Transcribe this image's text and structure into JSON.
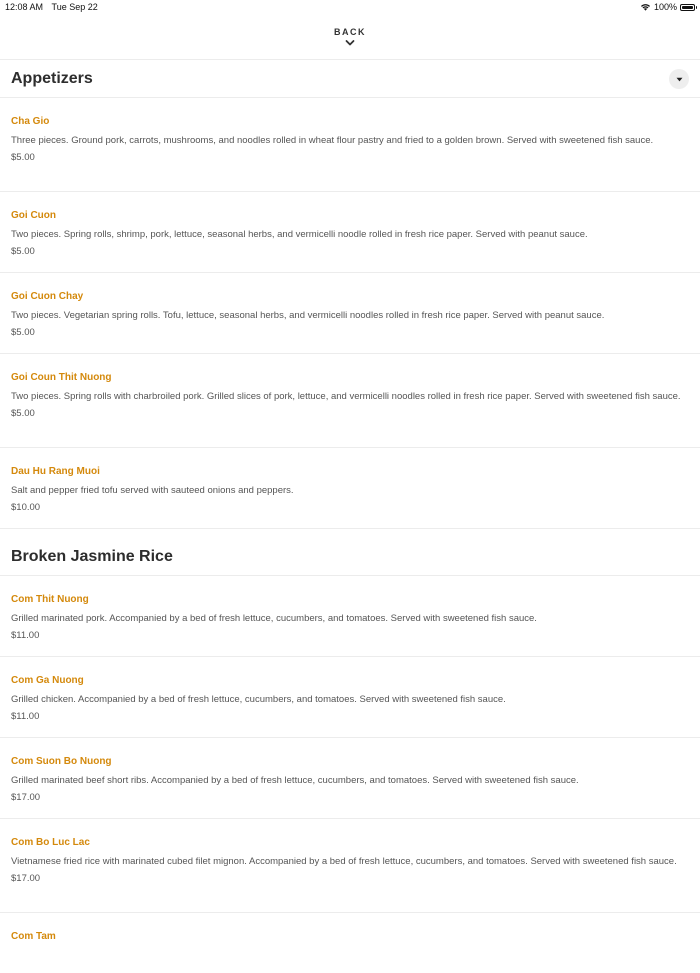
{
  "status_bar": {
    "time": "12:08 AM",
    "date": "Tue Sep 22",
    "battery_text": "100%",
    "icons": [
      "wifi-icon",
      "battery-icon"
    ]
  },
  "nav": {
    "back_label": "BACK",
    "back_icon": "chevron-down-icon"
  },
  "sections": [
    {
      "title": "Appetizers",
      "collapse_icon": "caret-down-icon",
      "items": [
        {
          "name": "Cha Gio",
          "description": "Three pieces. Ground pork, carrots, mushrooms, and noodles rolled in wheat flour pastry and fried to a golden brown. Served with sweetened fish sauce.",
          "price": "$5.00"
        },
        {
          "name": "Goi Cuon",
          "description": "Two pieces. Spring rolls, shrimp, pork, lettuce, seasonal herbs, and vermicelli noodle rolled in fresh rice paper. Served with peanut sauce.",
          "price": "$5.00"
        },
        {
          "name": "Goi Cuon Chay",
          "description": "Two pieces. Vegetarian spring rolls. Tofu, lettuce, seasonal herbs, and vermicelli noodles rolled in fresh rice paper. Served with peanut sauce.",
          "price": "$5.00"
        },
        {
          "name": "Goi Coun Thit Nuong",
          "description": "Two pieces. Spring rolls with charbroiled pork. Grilled slices of pork, lettuce, and vermicelli noodles rolled in fresh rice paper. Served with sweetened fish sauce.",
          "price": "$5.00"
        },
        {
          "name": "Dau Hu Rang Muoi",
          "description": "Salt and pepper fried tofu served with sauteed onions and peppers.",
          "price": "$10.00"
        }
      ]
    },
    {
      "title": "Broken Jasmine Rice",
      "items": [
        {
          "name": "Com Thit Nuong",
          "description": "Grilled marinated pork. Accompanied by a bed of fresh lettuce, cucumbers, and tomatoes. Served with sweetened fish sauce.",
          "price": "$11.00"
        },
        {
          "name": "Com Ga Nuong",
          "description": "Grilled chicken. Accompanied by a bed of fresh lettuce, cucumbers, and tomatoes. Served with sweetened fish sauce.",
          "price": "$11.00"
        },
        {
          "name": "Com Suon Bo Nuong",
          "description": "Grilled marinated beef short ribs. Accompanied by a bed of fresh lettuce, cucumbers, and tomatoes. Served with sweetened fish sauce.",
          "price": "$17.00"
        },
        {
          "name": "Com Bo Luc Lac",
          "description": "Vietnamese fried rice with marinated cubed filet mignon. Accompanied by a bed of fresh lettuce, cucumbers, and tomatoes. Served with sweetened fish sauce.",
          "price": "$17.00"
        },
        {
          "name": "Com Tam",
          "description": "",
          "price": ""
        }
      ]
    }
  ],
  "colors": {
    "item_name": "#d4890c",
    "divider": "#ececec",
    "title": "#2d2d2d"
  }
}
